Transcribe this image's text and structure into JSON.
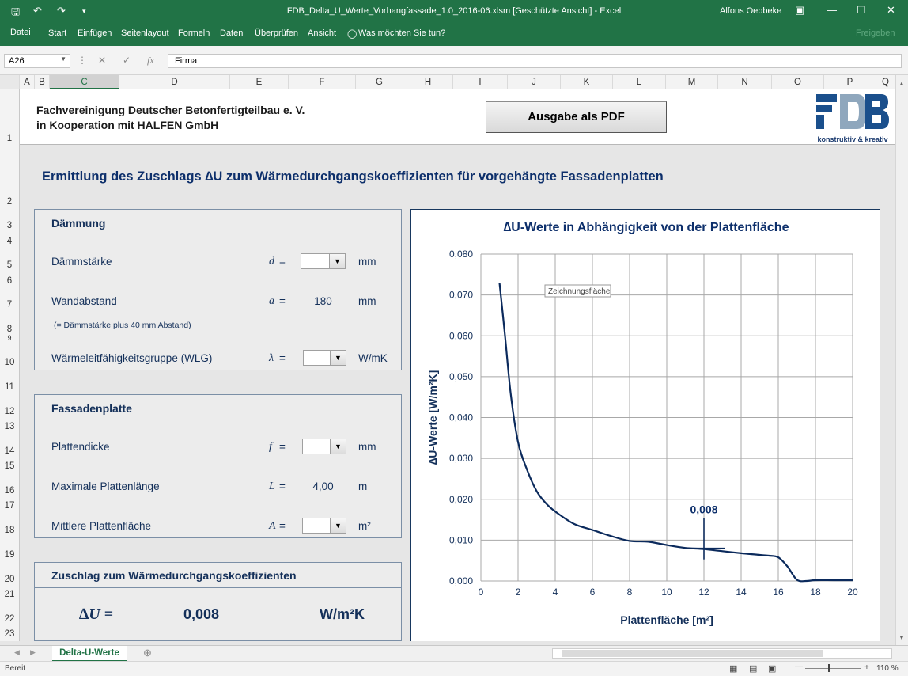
{
  "window": {
    "title": "FDB_Delta_U_Werte_Vorhangfassade_1.0_2016-06.xlsm  [Geschützte Ansicht]  -  Excel",
    "user": "Alfons Oebbeke"
  },
  "ribbon": {
    "tabs": [
      "Datei",
      "Start",
      "Einfügen",
      "Seitenlayout",
      "Formeln",
      "Daten",
      "Überprüfen",
      "Ansicht"
    ],
    "tell_me": "Was möchten Sie tun?",
    "share": "Freigeben"
  },
  "formula_bar": {
    "name_box": "A26",
    "fx": "fx",
    "content": "Firma"
  },
  "columns": [
    "A",
    "B",
    "C",
    "D",
    "E",
    "F",
    "G",
    "H",
    "I",
    "J",
    "K",
    "L",
    "M",
    "N",
    "O",
    "P",
    "Q"
  ],
  "rows": [
    "1",
    "2",
    "3",
    "4",
    "5",
    "6",
    "7",
    "8",
    "9",
    "10",
    "11",
    "12",
    "13",
    "14",
    "15",
    "16",
    "17",
    "18",
    "19",
    "20",
    "21",
    "22",
    "23"
  ],
  "header": {
    "org_line1": "Fachvereinigung Deutscher Betonfertigteilbau e. V.",
    "org_line2": "in Kooperation mit HALFEN GmbH",
    "pdf_button": "Ausgabe als PDF",
    "logo_tagline": "konstruktiv & kreativ"
  },
  "main_title": "Ermittlung des Zuschlags ∆U zum Wärmedurchgangskoeffizienten für vorgehängte Fassadenplatten",
  "daemmung": {
    "title": "Dämmung",
    "thickness_label": "Dämmstärke",
    "thickness_symbol": "d",
    "thickness_unit": "mm",
    "wall_label": "Wandabstand",
    "wall_symbol": "a",
    "wall_value": "180",
    "wall_unit": "mm",
    "wall_note": "(= Dämmstärke plus 40 mm Abstand)",
    "wlg_label": "Wärmeleitfähigkeitsgruppe (WLG)",
    "wlg_symbol": "λ",
    "wlg_unit": "W/mK",
    "eq": "="
  },
  "fassade": {
    "title": "Fassadenplatte",
    "thickness_label": "Plattendicke",
    "thickness_symbol": "f",
    "thickness_unit": "mm",
    "length_label": "Maximale Plattenlänge",
    "length_symbol": "L",
    "length_value": "4,00",
    "length_unit": "m",
    "area_label": "Mittlere Plattenfläche",
    "area_symbol": "A",
    "area_unit": "m²",
    "eq": "="
  },
  "result": {
    "title": "Zuschlag zum Wärmedurchgangskoeffizienten",
    "symbol": "∆U =",
    "value": "0,008",
    "unit": "W/m²K"
  },
  "chart_data": {
    "type": "line",
    "title": "∆U-Werte in Abhängigkeit von der Plattenfläche",
    "xlabel": "Plattenfläche [m²]",
    "ylabel": "∆U-Werte [W/m²K]",
    "xlim": [
      0,
      20
    ],
    "ylim": [
      0,
      0.08
    ],
    "x_ticks": [
      "0",
      "2",
      "4",
      "6",
      "8",
      "10",
      "12",
      "14",
      "16",
      "18",
      "20"
    ],
    "y_ticks": [
      "0,000",
      "0,010",
      "0,020",
      "0,030",
      "0,040",
      "0,050",
      "0,060",
      "0,070",
      "0,080"
    ],
    "grid": true,
    "tooltip": "Zeichnungsfläche",
    "marker_label": "0,008",
    "marker": {
      "x": 12,
      "y": 0.008
    },
    "series": [
      {
        "color": "#0b2a5c",
        "x": [
          1.0,
          1.3,
          1.6,
          2.0,
          2.5,
          3.0,
          3.5,
          4.0,
          5.0,
          6.0,
          7.0,
          8.0,
          9.0,
          10.0,
          11.0,
          12.0,
          13.0,
          14.0,
          15.0,
          15.5,
          16.0,
          16.5,
          17.0,
          17.5,
          18.0,
          19.0,
          20.0
        ],
        "y": [
          0.073,
          0.06,
          0.046,
          0.034,
          0.027,
          0.022,
          0.019,
          0.017,
          0.014,
          0.0125,
          0.011,
          0.0098,
          0.0096,
          0.0088,
          0.0081,
          0.0078,
          0.0073,
          0.0068,
          0.0064,
          0.0062,
          0.0058,
          0.0035,
          0.0003,
          0.0,
          0.0002,
          0.0002,
          0.0002
        ]
      }
    ]
  },
  "sheet_tab": "Delta-U-Werte",
  "status": {
    "ready": "Bereit",
    "zoom": "110 %"
  },
  "colors": {
    "excel_green": "#217346",
    "dark_navy": "#0d2f6b",
    "chart_line": "#0b2a5c"
  }
}
